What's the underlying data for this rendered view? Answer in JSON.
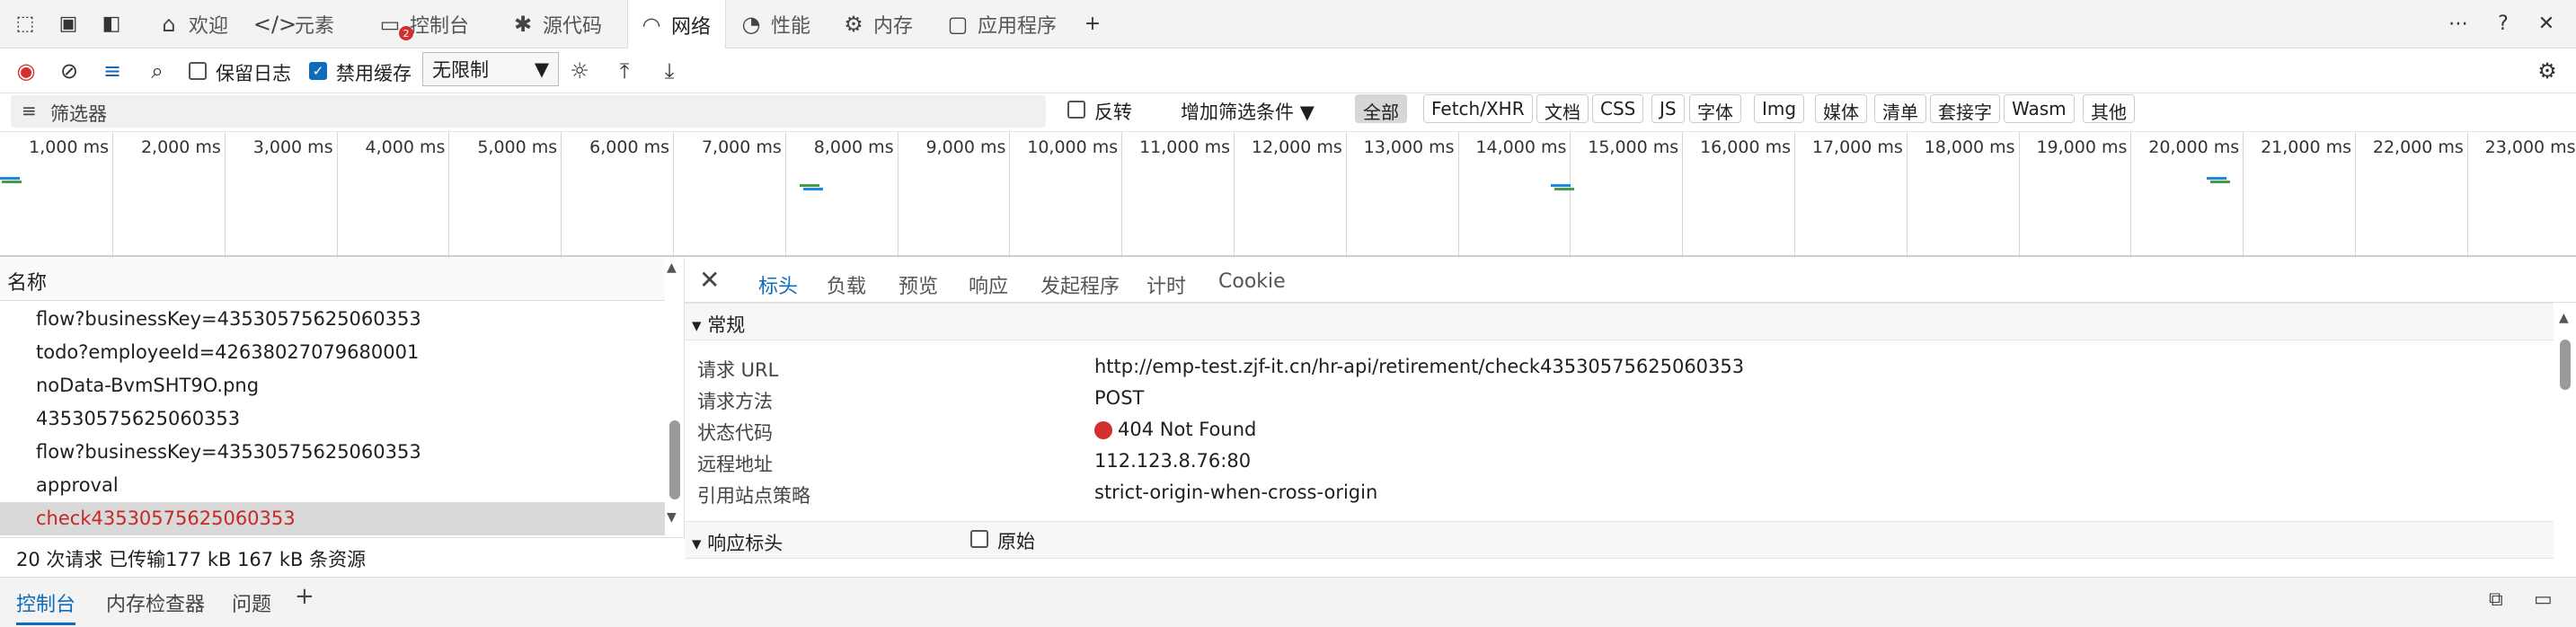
{
  "tabs": [
    {
      "label": "欢迎",
      "icon": "home-icon"
    },
    {
      "label": "元素",
      "icon": "code-icon"
    },
    {
      "label": "控制台",
      "icon": "console-icon"
    },
    {
      "label": "源代码",
      "icon": "bug-icon"
    },
    {
      "label": "网络",
      "icon": "wifi-icon"
    },
    {
      "label": "性能",
      "icon": "gauge-icon"
    },
    {
      "label": "内存",
      "icon": "chip-icon"
    },
    {
      "label": "应用程序",
      "icon": "app-icon"
    }
  ],
  "badge_count": "2",
  "toolbar": {
    "preserve_log": "保留日志",
    "disable_cache": "禁用缓存",
    "throttle": "无限制"
  },
  "filter": {
    "placeholder": "筛选器",
    "invert": "反转",
    "more_filters": "增加筛选条件",
    "types": [
      "全部",
      "Fetch/XHR",
      "文档",
      "CSS",
      "JS",
      "字体",
      "Img",
      "媒体",
      "清单",
      "套接字",
      "Wasm",
      "其他"
    ]
  },
  "timeline": {
    "ticks": [
      "1,000 ms",
      "2,000 ms",
      "3,000 ms",
      "4,000 ms",
      "5,000 ms",
      "6,000 ms",
      "7,000 ms",
      "8,000 ms",
      "9,000 ms",
      "10,000 ms",
      "11,000 ms",
      "12,000 ms",
      "13,000 ms",
      "14,000 ms",
      "15,000 ms",
      "16,000 ms",
      "17,000 ms",
      "18,000 ms",
      "19,000 ms",
      "20,000 ms",
      "21,000 ms",
      "22,000 ms",
      "23,000 ms"
    ]
  },
  "requests": {
    "header": "名称",
    "rows": [
      "flow?businessKey=43530575625060353",
      "todo?employeeId=42638027079680001",
      "noData-BvmSHT9O.png",
      "43530575625060353",
      "flow?businessKey=43530575625060353",
      "approval",
      "check43530575625060353"
    ],
    "summary": "20 次请求   已传输177 kB   167 kB 条资源"
  },
  "details": {
    "tabs": [
      "标头",
      "负载",
      "预览",
      "响应",
      "发起程序",
      "计时",
      "Cookie"
    ],
    "general_title": "常规",
    "general": [
      {
        "k": "请求 URL",
        "v": "http://emp-test.zjf-it.cn/hr-api/retirement/check43530575625060353"
      },
      {
        "k": "请求方法",
        "v": "POST"
      },
      {
        "k": "状态代码",
        "v": "404 Not Found"
      },
      {
        "k": "远程地址",
        "v": "112.123.8.76:80"
      },
      {
        "k": "引用站点策略",
        "v": "strict-origin-when-cross-origin"
      }
    ],
    "response_headers_title": "响应标头",
    "raw": "原始"
  },
  "drawer": {
    "tabs": [
      "控制台",
      "内存检查器",
      "问题"
    ]
  },
  "colors": {
    "accent": "#0f6cbd",
    "error": "#d32f2f"
  }
}
